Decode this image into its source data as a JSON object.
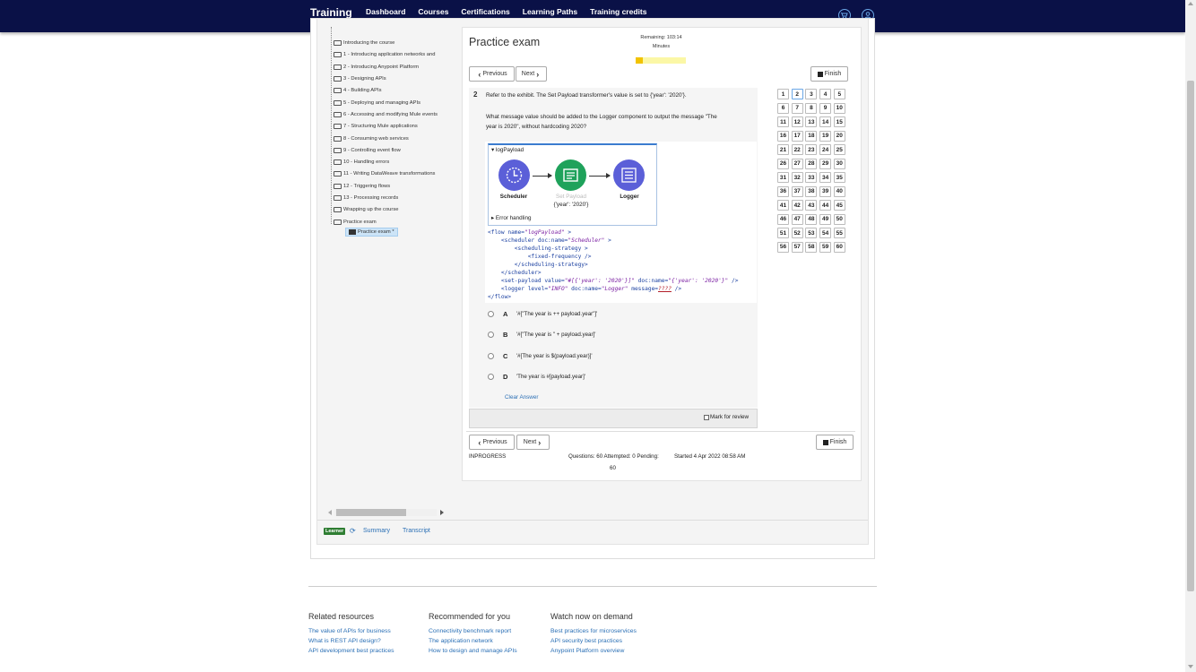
{
  "nav": {
    "brand": "Training",
    "links": [
      "Dashboard",
      "Courses",
      "Certifications",
      "Learning Paths",
      "Training credits"
    ]
  },
  "tree": {
    "items": [
      "Introducing the course",
      "1 - Introducing application networks and",
      "2 - Introducing Anypoint Platform",
      "3 - Designing APIs",
      "4 - Building APIs",
      "5 - Deploying and managing APIs",
      "6 - Accessing and modifying Mule events",
      "7 - Structuring Mule applications",
      "8 - Consuming web services",
      "9 - Controlling event flow",
      "10 - Handling errors",
      "11 - Writing DataWeave transformations",
      "12 - Triggering flows",
      "13 - Processing records",
      "Wrapping up the course",
      "Practice exam"
    ],
    "selected": "Practice exam *"
  },
  "bottom": {
    "learner": "Learner",
    "summary": "Summary",
    "transcript": "Transcript"
  },
  "exam": {
    "title": "Practice exam",
    "remaining": "Remaining: 103:14",
    "minutes": "Minutes",
    "progress": 0.14,
    "prev": "Previous",
    "next": "Next",
    "finish": "Finish",
    "qnum": "2",
    "q1": "Refer to the exhibit. The Set Payload transformer's value is set to {'year': '2020'}.",
    "q2": "What message value should be added to the Logger component to output the message \"The",
    "q3": "year is 2020\", without hardcoding 2020?",
    "flow_name": "logPayload",
    "scheduler": "Scheduler",
    "setpayload": "Set Payload",
    "setpayload_val": "{'year': '2020'}",
    "logger": "Logger",
    "error_handling": "Error handling",
    "options": [
      {
        "letter": "A",
        "text": "'#[\"The year is ++ payload.year\"]'"
      },
      {
        "letter": "B",
        "text": "'#[\"The year is \" + payload.year]'"
      },
      {
        "letter": "C",
        "text": "'#[The year is $(payload.year)]'"
      },
      {
        "letter": "D",
        "text": "'The year is #[payload.year]'"
      }
    ],
    "clear": "Clear Answer",
    "mark": "Mark for review",
    "status": "INPROGRESS",
    "questions": "Questions: 60 Attempted: 0 Pending:",
    "pending": "60",
    "started": "Started 4 Apr 2022 08:58 AM"
  },
  "footer": {
    "related": {
      "title": "Related resources",
      "links": [
        "The value of APIs for business",
        "What is REST API design?",
        "API development best practices"
      ]
    },
    "recommended": {
      "title": "Recommended for you",
      "links": [
        "Connectivity benchmark report",
        "The application network",
        "How to design and manage APIs"
      ]
    },
    "watch": {
      "title": "Watch now on demand",
      "links": [
        "Best practices for microservices",
        "API security best practices",
        "Anypoint Platform overview"
      ]
    }
  }
}
